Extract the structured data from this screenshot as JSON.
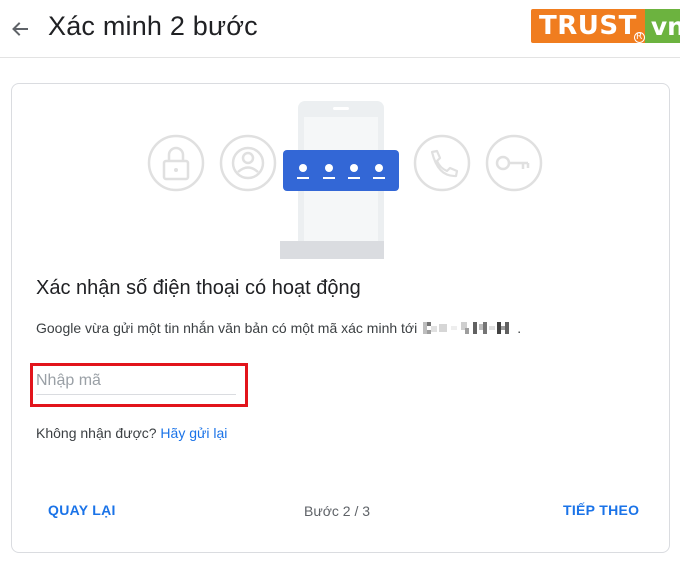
{
  "header": {
    "back_icon": "arrow-left-icon",
    "title": "Xác minh 2 bước"
  },
  "logo": {
    "text_main": "TRUST",
    "text_suffix": "vn",
    "registered_mark": "R",
    "colors": {
      "main": "#f07d1f",
      "suffix": "#6cb33f"
    }
  },
  "illustration": {
    "icons": [
      "lock-icon",
      "account-icon",
      "phone-call-icon",
      "key-icon"
    ],
    "code_digits": 4,
    "accent": "#3367d6"
  },
  "content": {
    "heading": "Xác nhận số điện thoại có hoạt động",
    "description": "Google vừa gửi một tin nhắn văn bản có một mã xác minh tới",
    "description_end": ".",
    "code_input": {
      "placeholder": "Nhập mã",
      "value": ""
    },
    "resend_prompt": "Không nhận được?",
    "resend_link": "Hãy gửi lại"
  },
  "footer": {
    "back_label": "QUAY LẠI",
    "step_label": "Bước 2 / 3",
    "next_label": "TIẾP THEO"
  },
  "colors": {
    "primary": "#1a73e8",
    "highlight": "#e2141b"
  }
}
